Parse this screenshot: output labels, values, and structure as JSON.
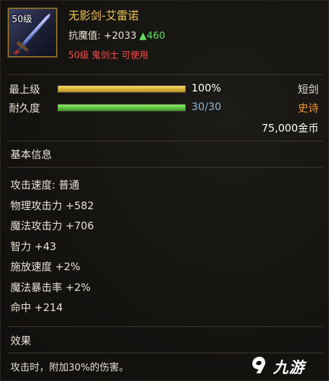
{
  "item": {
    "level_tag": "50级",
    "name": "无影剑-艾雷诺",
    "resist_label": "抗魔值: +2033",
    "resist_bonus": "▲460",
    "requirement": "50级 鬼剑士 可使用",
    "icon": "sword-icon"
  },
  "grade": {
    "label": "最上级",
    "value": "100%",
    "fraction": 1.0,
    "color": "#f0c64e"
  },
  "durability": {
    "label": "耐久度",
    "value": "30/30",
    "fraction": 1.0,
    "color": "#5fd43e"
  },
  "type": "短剑",
  "rarity": {
    "label": "史诗",
    "color": "#f59a2a"
  },
  "price": "75,000金币",
  "basic_info": {
    "title": "基本信息",
    "stats": [
      "攻击速度: 普通",
      "物理攻击力 +582",
      "魔法攻击力 +706",
      "智力 +43",
      "施放速度 +2%",
      "魔法暴击率 +2%",
      "命中 +214"
    ]
  },
  "effect": {
    "title": "效果",
    "text": "攻击时，附加30%的伤害。"
  },
  "watermark": {
    "text": "九游",
    "icon": "jiuyou-logo-icon"
  }
}
